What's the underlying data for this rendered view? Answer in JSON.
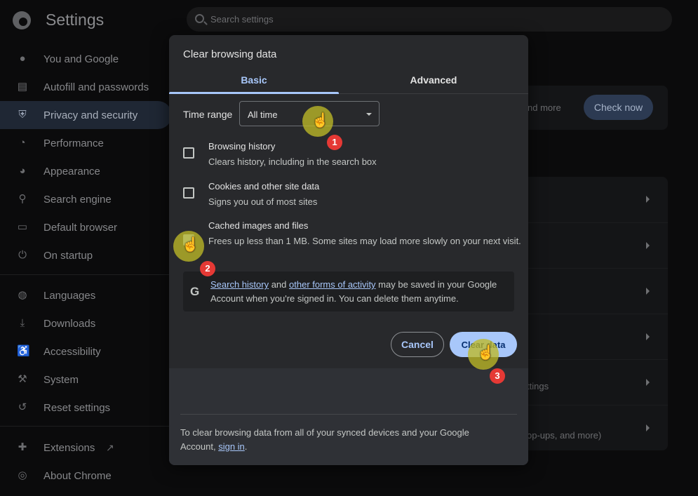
{
  "app": {
    "title": "Settings"
  },
  "search": {
    "placeholder": "Search settings"
  },
  "sidebar": {
    "items": [
      {
        "label": "You and Google"
      },
      {
        "label": "Autofill and passwords"
      },
      {
        "label": "Privacy and security"
      },
      {
        "label": "Performance"
      },
      {
        "label": "Appearance"
      },
      {
        "label": "Search engine"
      },
      {
        "label": "Default browser"
      },
      {
        "label": "On startup"
      },
      {
        "label": "Languages"
      },
      {
        "label": "Downloads"
      },
      {
        "label": "Accessibility"
      },
      {
        "label": "System"
      },
      {
        "label": "Reset settings"
      },
      {
        "label": "Extensions"
      },
      {
        "label": "About Chrome"
      }
    ]
  },
  "background": {
    "learn_more_fragment": "nd more",
    "check_now": "Check now",
    "row5_sub": "ttings",
    "row6_sub": "op-ups, and more)"
  },
  "dialog": {
    "title": "Clear browsing data",
    "tabs": [
      {
        "label": "Basic"
      },
      {
        "label": "Advanced"
      }
    ],
    "active_tab": "Basic",
    "time_range": {
      "label": "Time range",
      "value": "All time"
    },
    "options": [
      {
        "title": "Browsing history",
        "desc": "Clears history, including in the search box",
        "checked": false
      },
      {
        "title": "Cookies and other site data",
        "desc": "Signs you out of most sites",
        "checked": false
      },
      {
        "title": "Cached images and files",
        "desc": "Frees up less than 1 MB. Some sites may load more slowly on your next visit.",
        "checked": true
      }
    ],
    "google_notice": {
      "link1": "Search history",
      "mid1": " and ",
      "link2": "other forms of activity",
      "rest": " may be saved in your Google Account when you're signed in. You can delete them anytime."
    },
    "cancel": "Cancel",
    "clear": "Clear data",
    "footer": {
      "text": "To clear browsing data from all of your synced devices and your Google Account, ",
      "link": "sign in",
      "end": "."
    }
  },
  "annotations": [
    {
      "number": "1"
    },
    {
      "number": "2"
    },
    {
      "number": "3"
    }
  ],
  "colors": {
    "accent": "#a8c7fa",
    "badge": "#e53935",
    "highlight": "#beb928"
  }
}
